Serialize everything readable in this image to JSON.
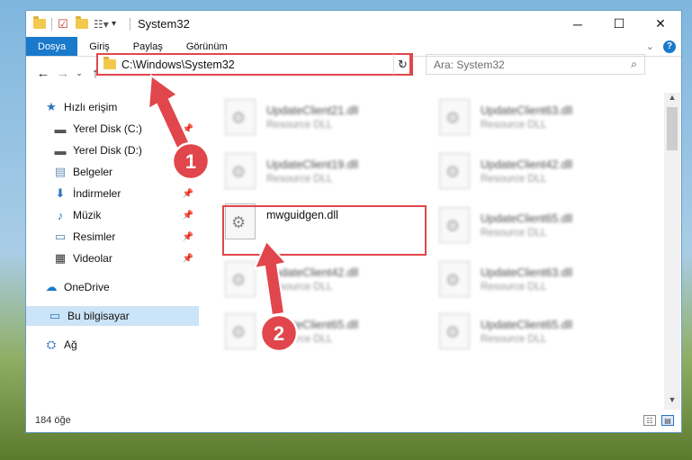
{
  "window": {
    "title": "System32"
  },
  "ribbon": {
    "tabs": [
      {
        "label": "Dosya",
        "active": true
      },
      {
        "label": "Giriş",
        "active": false
      },
      {
        "label": "Paylaş",
        "active": false
      },
      {
        "label": "Görünüm",
        "active": false
      }
    ],
    "help": "?"
  },
  "address_bar": {
    "path": "C:\\Windows\\System32"
  },
  "search": {
    "placeholder": "Ara: System32"
  },
  "nav": {
    "quick_access": "Hızlı erişim",
    "items": [
      {
        "label": "Yerel Disk (C:)",
        "icon": "drive-icon",
        "pinned": true
      },
      {
        "label": "Yerel Disk (D:)",
        "icon": "drive-icon",
        "pinned": true
      },
      {
        "label": "Belgeler",
        "icon": "documents-icon",
        "pinned": true
      },
      {
        "label": "İndirmeler",
        "icon": "download-icon",
        "pinned": true
      },
      {
        "label": "Müzik",
        "icon": "music-icon",
        "pinned": true
      },
      {
        "label": "Resimler",
        "icon": "pictures-icon",
        "pinned": true
      },
      {
        "label": "Videolar",
        "icon": "video-icon",
        "pinned": true
      }
    ],
    "onedrive": "OneDrive",
    "this_pc": "Bu bilgisayar",
    "network": "Ağ"
  },
  "files": {
    "left": [
      {
        "name": "UpdateClient21.dll",
        "desc": "Resource DLL"
      },
      {
        "name": "UpdateClient19.dll",
        "desc": "Resource DLL"
      },
      {
        "name": "mwguidgen.dll",
        "desc": ""
      },
      {
        "name": "UpdateClient42.dll",
        "desc": "Resource DLL"
      },
      {
        "name": "UpdateClient65.dll",
        "desc": "Resource DLL"
      }
    ],
    "right": [
      {
        "name": "UpdateClient63.dll",
        "desc": "Resource DLL"
      },
      {
        "name": "UpdateClient42.dll",
        "desc": "Resource DLL"
      },
      {
        "name": "UpdateClient65.dll",
        "desc": "Resource DLL"
      },
      {
        "name": "UpdateClient63.dll",
        "desc": "Resource DLL"
      },
      {
        "name": "UpdateClient65.dll",
        "desc": "Resource DLL"
      }
    ]
  },
  "status": {
    "count": "184 öğe"
  },
  "annotations": {
    "step1": "1",
    "step2": "2",
    "color": "#e0464b"
  }
}
